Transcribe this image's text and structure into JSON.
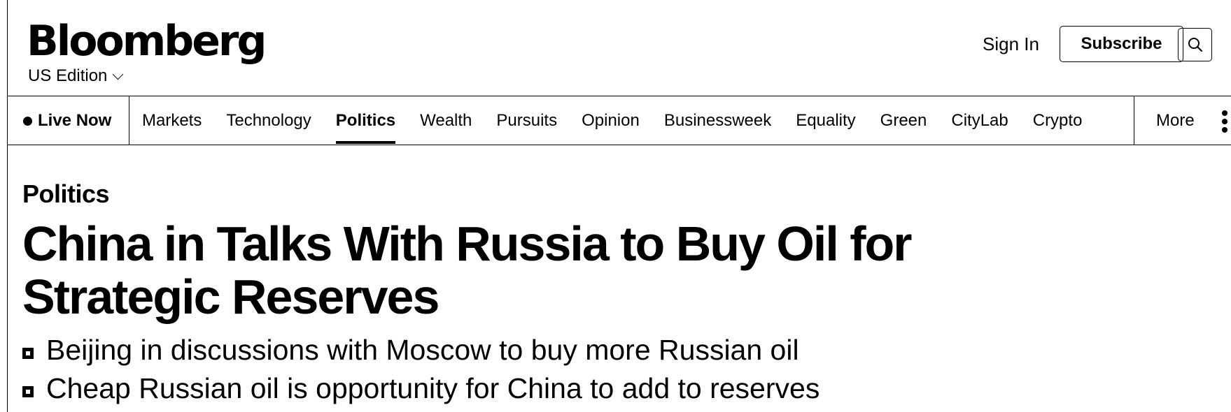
{
  "header": {
    "logo": "Bloomberg",
    "edition": "US Edition",
    "sign_in": "Sign In",
    "subscribe": "Subscribe"
  },
  "nav": {
    "live": "Live Now",
    "items": [
      "Markets",
      "Technology",
      "Politics",
      "Wealth",
      "Pursuits",
      "Opinion",
      "Businessweek",
      "Equality",
      "Green",
      "CityLab",
      "Crypto"
    ],
    "active": "Politics",
    "more": "More"
  },
  "article": {
    "section": "Politics",
    "headline": "China in Talks With Russia to Buy Oil for Strategic Reserves",
    "bullets": [
      "Beijing in discussions with Moscow to buy more Russian oil",
      "Cheap Russian oil is opportunity for China to add to reserves"
    ]
  },
  "icons": {
    "search": "search-icon",
    "chevron": "chevron-down-icon",
    "live_dot": "live-dot-icon",
    "more": "kebab-icon"
  }
}
